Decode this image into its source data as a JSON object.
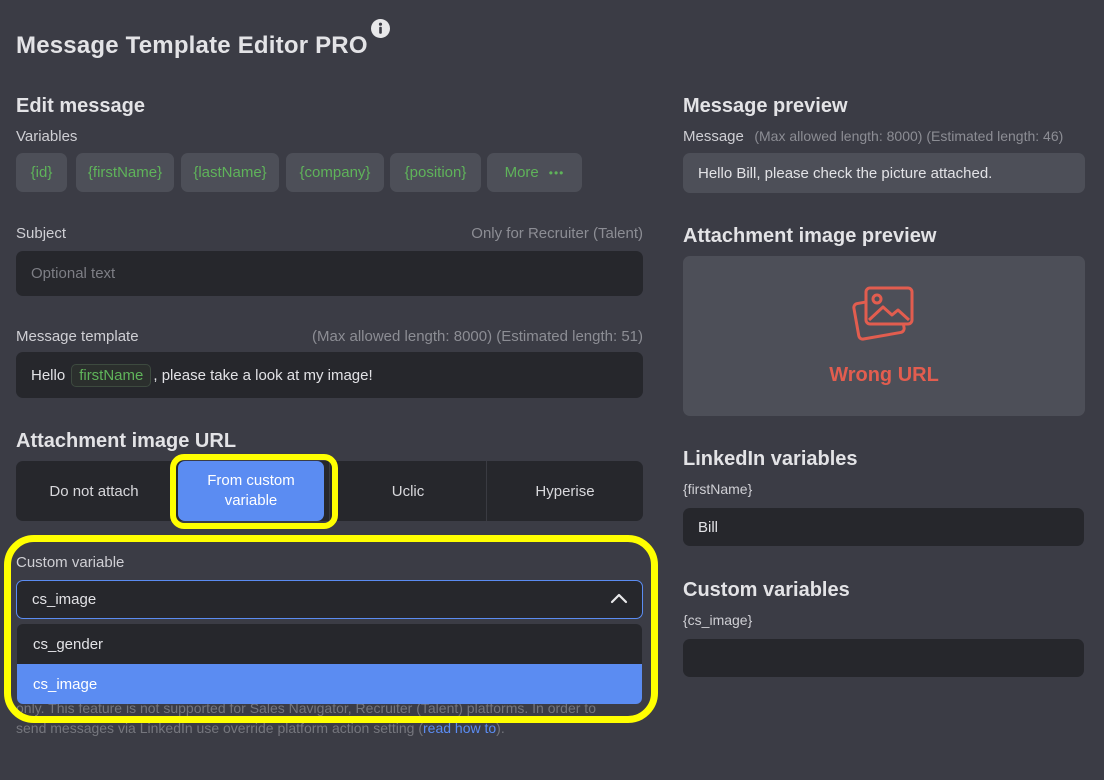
{
  "header": {
    "title": "Message Template Editor PRO",
    "info_icon": "info-circle-icon"
  },
  "edit": {
    "heading": "Edit message",
    "variables_label": "Variables",
    "chips": [
      "{id}",
      "{firstName}",
      "{lastName}",
      "{company}",
      "{position}"
    ],
    "more_label": "More",
    "more_dots": "•••",
    "subject_label": "Subject",
    "subject_hint": "Only for Recruiter (Talent)",
    "subject_placeholder": "Optional text",
    "template_label": "Message template",
    "template_hint": "(Max allowed length: 8000) (Estimated length: 51)",
    "template_prefix": "Hello",
    "template_chip": "firstName",
    "template_suffix": ", please take a look at my image!"
  },
  "attachment": {
    "heading": "Attachment image URL",
    "options": [
      "Do not attach",
      "From custom variable",
      "Uclic",
      "Hyperise"
    ],
    "active_option": "From custom\nvariable",
    "custom_label": "Custom variable",
    "selected_value": "cs_image",
    "dropdown_options": [
      "cs_gender",
      "cs_image"
    ],
    "footer_line1": "only. This feature is not supported for Sales Navigator, Recruiter (Talent) platforms. In order to",
    "footer_line2_prefix": "send messages via LinkedIn use override platform action setting (",
    "footer_link": "read how to",
    "footer_line2_suffix": ")."
  },
  "preview": {
    "heading": "Message preview",
    "message_label": "Message",
    "message_hint": "(Max allowed length: 8000) (Estimated length: 46)",
    "message_text": "Hello Bill, please check the picture attached.",
    "image_heading": "Attachment image preview",
    "image_error": "Wrong URL",
    "linkedin_heading": "LinkedIn variables",
    "linkedin_var_label": "{firstName}",
    "linkedin_var_value": "Bill",
    "custom_heading": "Custom variables",
    "custom_var_label": "{cs_image}",
    "custom_var_value": ""
  },
  "colors": {
    "background": "#3b3c45",
    "field": "#26272c",
    "accent": "#5b8cf2",
    "variable_green": "#5fb35a",
    "error_red": "#e25d4f",
    "highlight": "#ffff00"
  }
}
